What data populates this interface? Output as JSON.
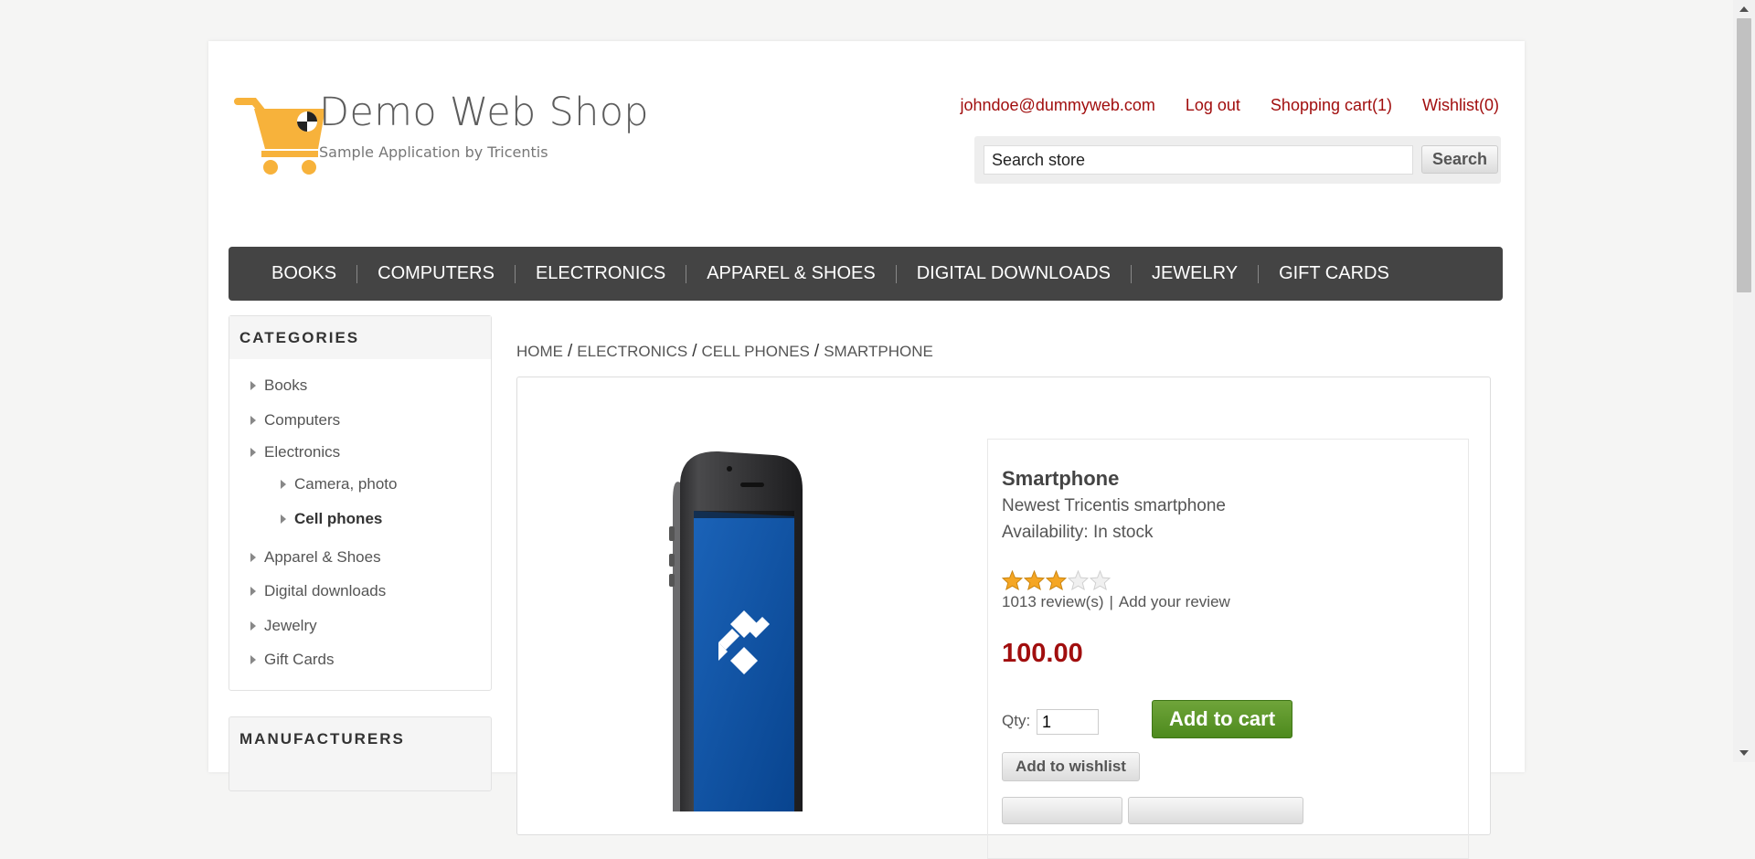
{
  "header": {
    "logo_title": "Demo Web Shop",
    "logo_subtitle": "Sample Application by Tricentis",
    "links": {
      "account": "johndoe@dummyweb.com",
      "logout": "Log out",
      "cart": "Shopping cart(1)",
      "wishlist": "Wishlist(0)"
    },
    "search": {
      "value": "Search store",
      "button": "Search"
    }
  },
  "top_menu": [
    "BOOKS",
    "COMPUTERS",
    "ELECTRONICS",
    "APPAREL & SHOES",
    "DIGITAL DOWNLOADS",
    "JEWELRY",
    "GIFT CARDS"
  ],
  "sidebar": {
    "categories_title": "CATEGORIES",
    "items": [
      "Books",
      "Computers",
      "Electronics",
      "Camera, photo",
      "Cell phones",
      "Apparel & Shoes",
      "Digital downloads",
      "Jewelry",
      "Gift Cards"
    ],
    "manufacturers_title": "MANUFACTURERS"
  },
  "breadcrumb": [
    "HOME",
    "ELECTRONICS",
    "CELL PHONES",
    "SMARTPHONE"
  ],
  "product": {
    "name": "Smartphone",
    "short_description": "Newest Tricentis smartphone",
    "availability": "Availability: In stock",
    "rating": 3,
    "rating_max": 5,
    "reviews": "1013 review(s)",
    "add_review": "Add your review",
    "price": "100.00",
    "qty_label": "Qty:",
    "qty_value": "1",
    "add_to_cart": "Add to cart",
    "add_to_wishlist": "Add to wishlist"
  },
  "colors": {
    "link_red": "#a10e0e",
    "menu_bg": "#444444",
    "cart_green": "#5a9527",
    "logo_orange": "#f7b23b",
    "star_gold": "#f5a623"
  }
}
